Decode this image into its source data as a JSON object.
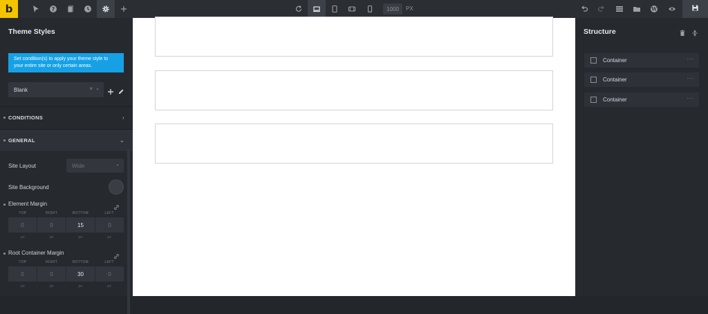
{
  "app": {
    "logo_letter": "b"
  },
  "toolbar": {
    "left_icons": [
      "cursor-icon",
      "help-icon",
      "pages-icon",
      "history-icon",
      "settings-icon",
      "plus-icon"
    ],
    "center_icons": [
      "refresh-icon",
      "laptop-icon",
      "tablet-icon",
      "tablet-landscape-icon",
      "mobile-icon"
    ],
    "width_value": "1000",
    "width_unit": "PX",
    "right_icons": [
      "undo-icon",
      "redo-icon",
      "rows-icon",
      "folder-icon",
      "wordpress-icon",
      "eye-icon",
      "save-icon"
    ]
  },
  "left_panel": {
    "title": "Theme Styles",
    "info": "Set condition(s) to apply your theme style to your entire site or only certain areas.",
    "style_select": {
      "value": "Blank",
      "clear": "×",
      "chevron": "⌄"
    },
    "sections": [
      {
        "label": "CONDITIONS",
        "arrow": "›"
      },
      {
        "label": "GENERAL",
        "arrow": "⌄"
      }
    ],
    "site_layout": {
      "label": "Site Layout",
      "value": "Wide",
      "chevron": "⌄"
    },
    "site_background": {
      "label": "Site Background"
    },
    "element_margin": {
      "label": "Element Margin",
      "labels": [
        "TOP",
        "RIGHT",
        "BOTTOM",
        "LEFT"
      ],
      "values": [
        "0",
        "0",
        "15",
        "0"
      ],
      "units": [
        "px",
        "px",
        "px",
        "px"
      ]
    },
    "root_margin": {
      "label": "Root Container Margin",
      "labels": [
        "TOP",
        "RIGHT",
        "BOTTOM",
        "LEFT"
      ],
      "values": [
        "0",
        "0",
        "30",
        "0"
      ],
      "units": [
        "px",
        "px",
        "px",
        "px"
      ]
    }
  },
  "right_panel": {
    "title": "Structure",
    "items": [
      {
        "label": "Container",
        "dots": "···"
      },
      {
        "label": "Container",
        "dots": "···"
      },
      {
        "label": "Container",
        "dots": "···"
      }
    ]
  }
}
